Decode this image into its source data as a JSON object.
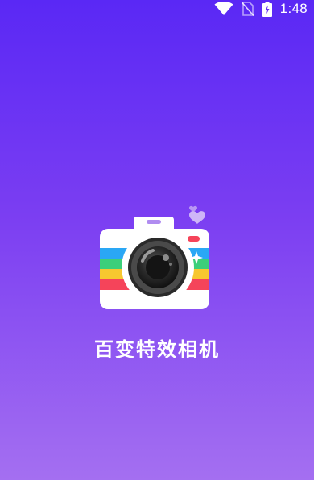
{
  "status_bar": {
    "time": "1:48",
    "icons": [
      "wifi-icon",
      "no-sim-icon",
      "battery-charging-icon"
    ]
  },
  "splash": {
    "app_name": "百变特效相机",
    "logo": "camera-logo-icon"
  },
  "colors": {
    "gradient_top": "#5a28f5",
    "gradient_bottom": "#a46ff1",
    "stripe_blue": "#2aa7f5",
    "stripe_green": "#3ccf7a",
    "stripe_yellow": "#f7c72f",
    "stripe_red": "#f5445a",
    "accent_purple": "#b08cf0"
  }
}
